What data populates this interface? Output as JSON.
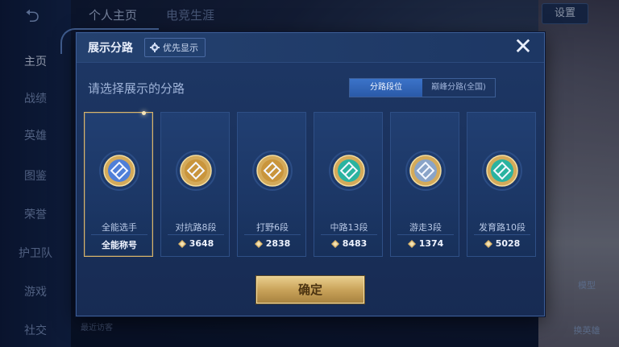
{
  "background": {
    "tabs": [
      "个人主页",
      "电竞生涯"
    ],
    "settings_label": "设置",
    "nav_items": [
      "主页",
      "战绩",
      "英雄",
      "图鉴",
      "荣誉",
      "护卫队",
      "游戏",
      "社交"
    ],
    "side_labels": [
      "模型",
      "换英雄"
    ],
    "recent_visitors": "最近访客"
  },
  "dialog": {
    "title": "展示分路",
    "priority_label": "优先显示",
    "close_icon": "close-icon",
    "subtitle": "请选择展示的分路",
    "toggle": [
      "分路段位",
      "巅峰分路(全国)"
    ],
    "toggle_active": 0,
    "confirm_label": "确定"
  },
  "cards": [
    {
      "name": "全能选手",
      "value": "全能称号",
      "icon": "all-round-emblem-icon",
      "selected": true,
      "accent": "#4f7fd8"
    },
    {
      "name": "对抗路8段",
      "value": "3648",
      "icon": "clash-lane-emblem-icon",
      "selected": false,
      "accent": "#c9953c"
    },
    {
      "name": "打野6段",
      "value": "2838",
      "icon": "jungle-emblem-icon",
      "selected": false,
      "accent": "#c9953c"
    },
    {
      "name": "中路13段",
      "value": "8483",
      "icon": "mid-lane-emblem-icon",
      "selected": false,
      "accent": "#2bb3a0"
    },
    {
      "name": "游走3段",
      "value": "1374",
      "icon": "roam-emblem-icon",
      "selected": false,
      "accent": "#8aa4c8"
    },
    {
      "name": "发育路10段",
      "value": "5028",
      "icon": "farm-lane-emblem-icon",
      "selected": false,
      "accent": "#2bb3a0"
    }
  ]
}
